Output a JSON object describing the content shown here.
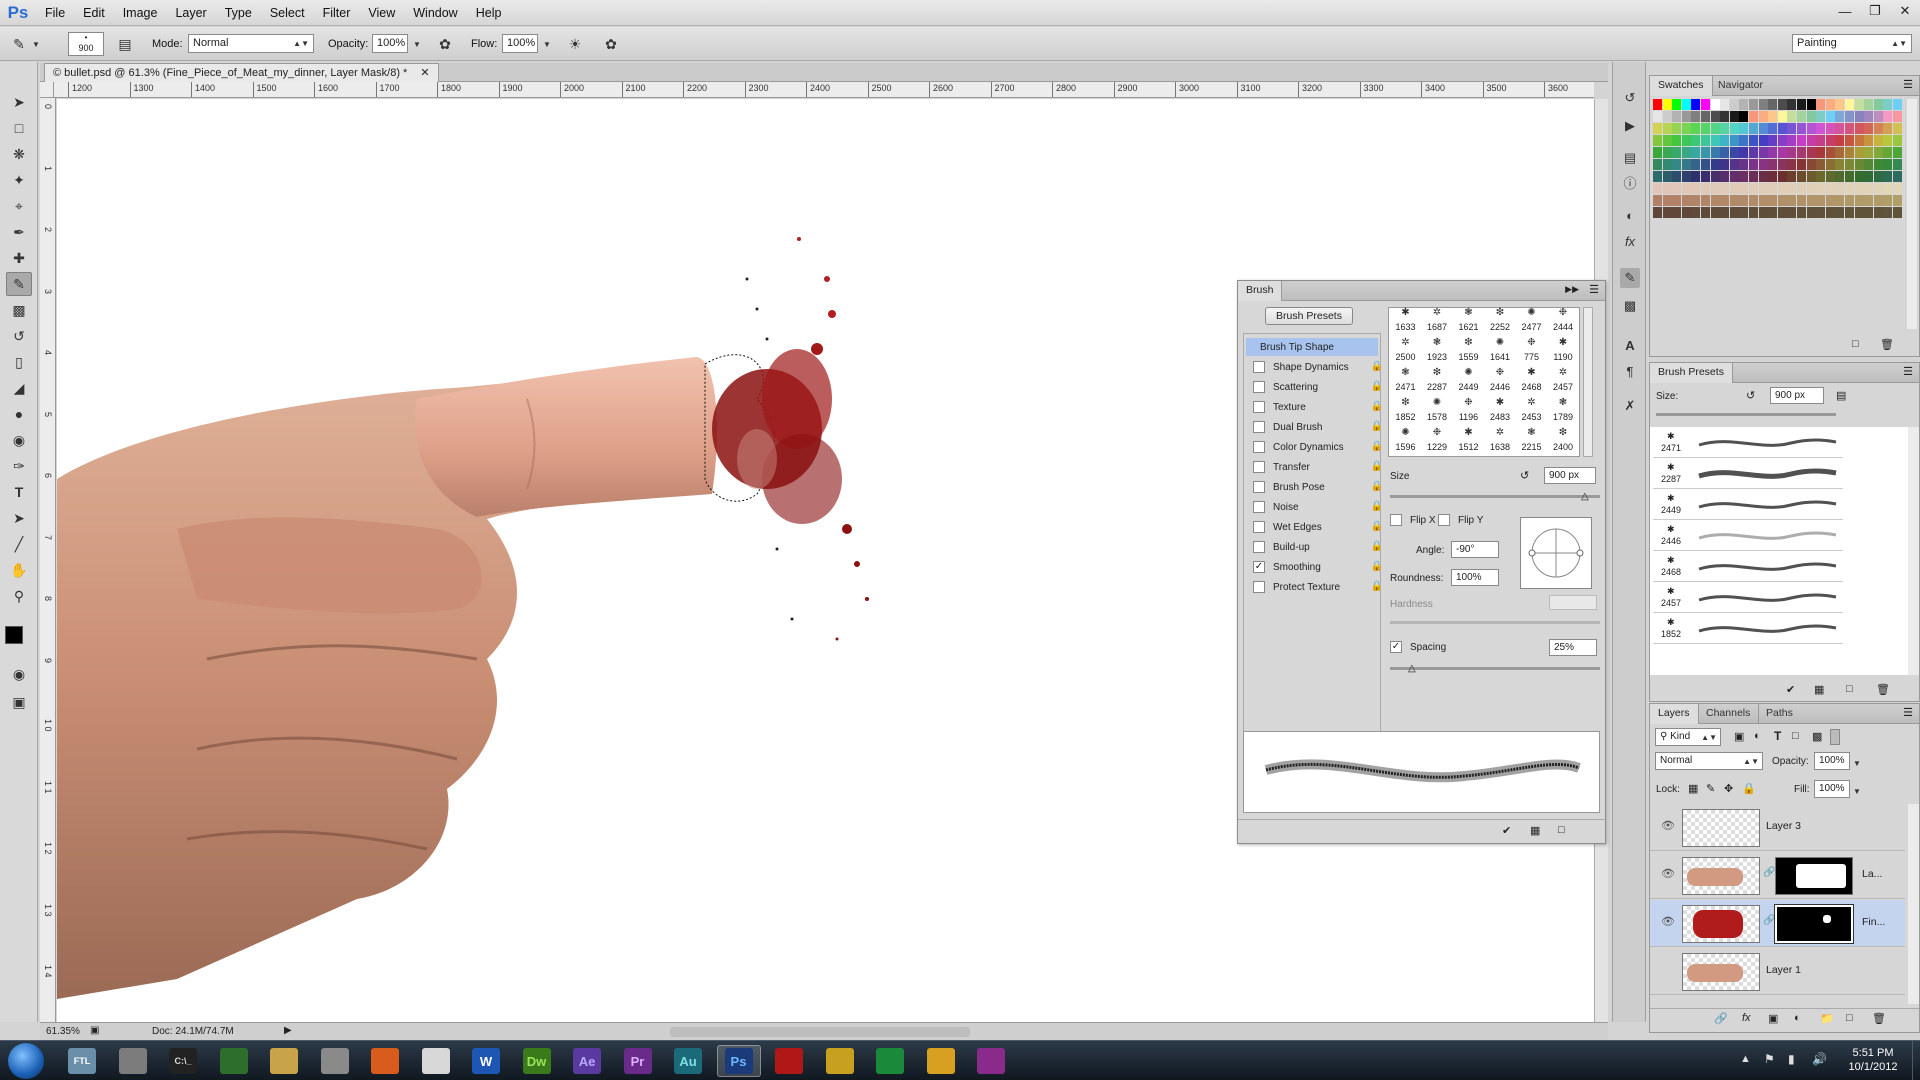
{
  "app": {
    "logo": "Ps",
    "workspace": "Painting"
  },
  "menu": [
    "File",
    "Edit",
    "Image",
    "Layer",
    "Type",
    "Select",
    "Filter",
    "View",
    "Window",
    "Help"
  ],
  "options": {
    "brush_size": "900",
    "mode_label": "Mode:",
    "mode_value": "Normal",
    "opacity_label": "Opacity:",
    "opacity_value": "100%",
    "flow_label": "Flow:",
    "flow_value": "100%"
  },
  "document": {
    "tab_title": "© bullet.psd @ 61.3% (Fine_Piece_of_Meat_my_dinner, Layer Mask/8) *",
    "ruler_h": [
      "1200",
      "1300",
      "1400",
      "1500",
      "1600",
      "1700",
      "1800",
      "1900",
      "2000",
      "2100",
      "2200",
      "2300",
      "2400",
      "2500",
      "2600",
      "2700",
      "2800",
      "2900",
      "3000",
      "3100",
      "3200",
      "3300",
      "3400",
      "3500",
      "3600"
    ],
    "ruler_v": [
      "0",
      "1",
      "2",
      "3",
      "4",
      "5",
      "6",
      "7",
      "8",
      "9",
      "1 0",
      "1 1",
      "1 2",
      "1 3",
      "1 4"
    ],
    "zoom": "61.35%",
    "doc_size": "Doc: 24.1M/74.7M"
  },
  "brush_panel": {
    "tabs": [
      "Brush"
    ],
    "presets_button": "Brush Presets",
    "options": [
      {
        "label": "Brush Tip Shape",
        "checkbox": false,
        "checked": false,
        "lock": false,
        "selected": true
      },
      {
        "label": "Shape Dynamics",
        "checkbox": true,
        "checked": false,
        "lock": true
      },
      {
        "label": "Scattering",
        "checkbox": true,
        "checked": false,
        "lock": true
      },
      {
        "label": "Texture",
        "checkbox": true,
        "checked": false,
        "lock": true
      },
      {
        "label": "Dual Brush",
        "checkbox": true,
        "checked": false,
        "lock": true
      },
      {
        "label": "Color Dynamics",
        "checkbox": true,
        "checked": false,
        "lock": true
      },
      {
        "label": "Transfer",
        "checkbox": true,
        "checked": false,
        "lock": true
      },
      {
        "label": "Brush Pose",
        "checkbox": true,
        "checked": false,
        "lock": true
      },
      {
        "label": "Noise",
        "checkbox": true,
        "checked": false,
        "lock": true
      },
      {
        "label": "Wet Edges",
        "checkbox": true,
        "checked": false,
        "lock": true
      },
      {
        "label": "Build-up",
        "checkbox": true,
        "checked": false,
        "lock": true
      },
      {
        "label": "Smoothing",
        "checkbox": true,
        "checked": true,
        "lock": true
      },
      {
        "label": "Protect Texture",
        "checkbox": true,
        "checked": false,
        "lock": true
      }
    ],
    "tips": [
      [
        "1633",
        "1687",
        "1621",
        "2252",
        "2477",
        "2444"
      ],
      [
        "2500",
        "1923",
        "1559",
        "1641",
        "775",
        "1190"
      ],
      [
        "2471",
        "2287",
        "2449",
        "2446",
        "2468",
        "2457"
      ],
      [
        "1852",
        "1578",
        "1196",
        "2483",
        "2453",
        "1789"
      ],
      [
        "1596",
        "1229",
        "1512",
        "1638",
        "2215",
        "2400"
      ]
    ],
    "size_label": "Size",
    "size_value": "900 px",
    "flip_x": "Flip X",
    "flip_y": "Flip Y",
    "angle_label": "Angle:",
    "angle_value": "-90°",
    "roundness_label": "Roundness:",
    "roundness_value": "100%",
    "hardness_label": "Hardness",
    "spacing_label": "Spacing",
    "spacing_value": "25%"
  },
  "swatches_panel": {
    "tabs": [
      "Swatches",
      "Navigator"
    ]
  },
  "brush_presets_panel": {
    "title": "Brush Presets",
    "size_label": "Size:",
    "size_value": "900 px",
    "items": [
      "2471",
      "2287",
      "2449",
      "2446",
      "2468",
      "2457",
      "1852"
    ]
  },
  "layers_panel": {
    "tabs": [
      "Layers",
      "Channels",
      "Paths"
    ],
    "kind": "Kind",
    "blend_mode": "Normal",
    "opacity_label": "Opacity:",
    "opacity_value": "100%",
    "lock_label": "Lock:",
    "fill_label": "Fill:",
    "fill_value": "100%",
    "layers": [
      {
        "name": "Layer 3",
        "visible": true,
        "mask": false,
        "selected": false,
        "thumb": "transparent"
      },
      {
        "name": "La...",
        "visible": true,
        "mask": true,
        "selected": false,
        "thumb": "hand"
      },
      {
        "name": "Fin...",
        "visible": true,
        "mask": true,
        "selected": true,
        "thumb": "meat"
      },
      {
        "name": "Layer 1",
        "visible": false,
        "mask": false,
        "selected": false,
        "thumb": "hand"
      }
    ]
  },
  "taskbar": {
    "apps": [
      "FTL",
      "",
      "C:\\_",
      "",
      "",
      "",
      "",
      "",
      "W",
      "Dw",
      "Ae",
      "Pr",
      "Au",
      "Ps",
      "",
      "",
      "",
      "",
      ""
    ],
    "time": "5:51 PM",
    "date": "10/1/2012"
  },
  "colors": {
    "accent": "#2a6fcf",
    "selection": "#c4d4ee",
    "blood": "#8b1010"
  }
}
